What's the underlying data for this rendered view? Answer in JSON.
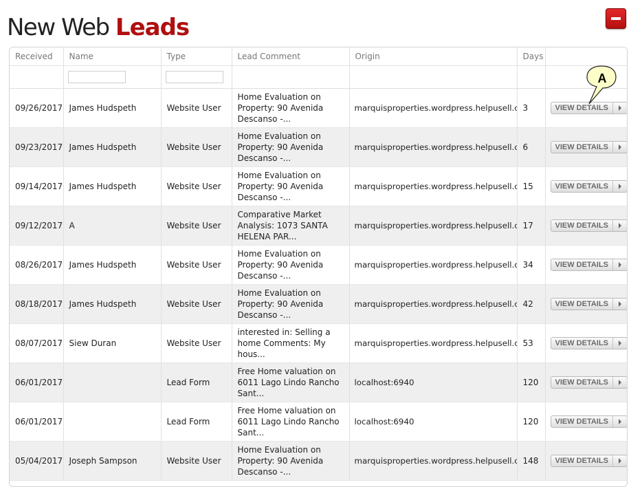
{
  "title": {
    "prefix": "New Web",
    "accent": "Leads"
  },
  "columns": [
    "Received",
    "Name",
    "Type",
    "Lead Comment",
    "Origin",
    "Days"
  ],
  "filters": {
    "name": "",
    "type": ""
  },
  "view_details_label": "VIEW DETAILS",
  "callout_label": "A",
  "rows": [
    {
      "received": "09/26/2017",
      "name": "James Hudspeth",
      "type": "Website User",
      "comment": "Home Evaluation on Property: 90 Avenida Descanso -...",
      "origin": "marquisproperties.wordpress.helpusell.com",
      "days": "3"
    },
    {
      "received": "09/23/2017",
      "name": "James Hudspeth",
      "type": "Website User",
      "comment": "Home Evaluation on Property: 90 Avenida Descanso -...",
      "origin": "marquisproperties.wordpress.helpusell.com",
      "days": "6"
    },
    {
      "received": "09/14/2017",
      "name": "James Hudspeth",
      "type": "Website User",
      "comment": "Home Evaluation on Property: 90 Avenida Descanso -...",
      "origin": "marquisproperties.wordpress.helpusell.com",
      "days": "15"
    },
    {
      "received": "09/12/2017",
      "name": "A",
      "type": "Website User",
      "comment": "Comparative Market Analysis: 1073 SANTA HELENA PAR...",
      "origin": "marquisproperties.wordpress.helpusell.com",
      "days": "17"
    },
    {
      "received": "08/26/2017",
      "name": "James Hudspeth",
      "type": "Website User",
      "comment": "Home Evaluation on Property: 90 Avenida Descanso -...",
      "origin": "marquisproperties.wordpress.helpusell.com",
      "days": "34"
    },
    {
      "received": "08/18/2017",
      "name": "James Hudspeth",
      "type": "Website User",
      "comment": "Home Evaluation on Property: 90 Avenida Descanso -...",
      "origin": "marquisproperties.wordpress.helpusell.com",
      "days": "42"
    },
    {
      "received": "08/07/2017",
      "name": "Siew Duran",
      "type": "Website User",
      "comment": "interested in: Selling a home Comments: My hous...",
      "origin": "marquisproperties.wordpress.helpusell.com",
      "days": "53"
    },
    {
      "received": "06/01/2017",
      "name": "",
      "type": "Lead Form",
      "comment": "Free Home valuation on 6011 Lago Lindo Rancho Sant...",
      "origin": "localhost:6940",
      "days": "120"
    },
    {
      "received": "06/01/2017",
      "name": "",
      "type": "Lead Form",
      "comment": "Free Home valuation on 6011 Lago Lindo Rancho Sant...",
      "origin": "localhost:6940",
      "days": "120"
    },
    {
      "received": "05/04/2017",
      "name": "Joseph Sampson",
      "type": "Website User",
      "comment": "Home Evaluation on Property: 90 Avenida Descanso -...",
      "origin": "marquisproperties.wordpress.helpusell.com",
      "days": "148"
    }
  ],
  "colors": {
    "accent": "#b00f10",
    "row_alt": "#efefef",
    "button_red": "#d41c1d"
  }
}
